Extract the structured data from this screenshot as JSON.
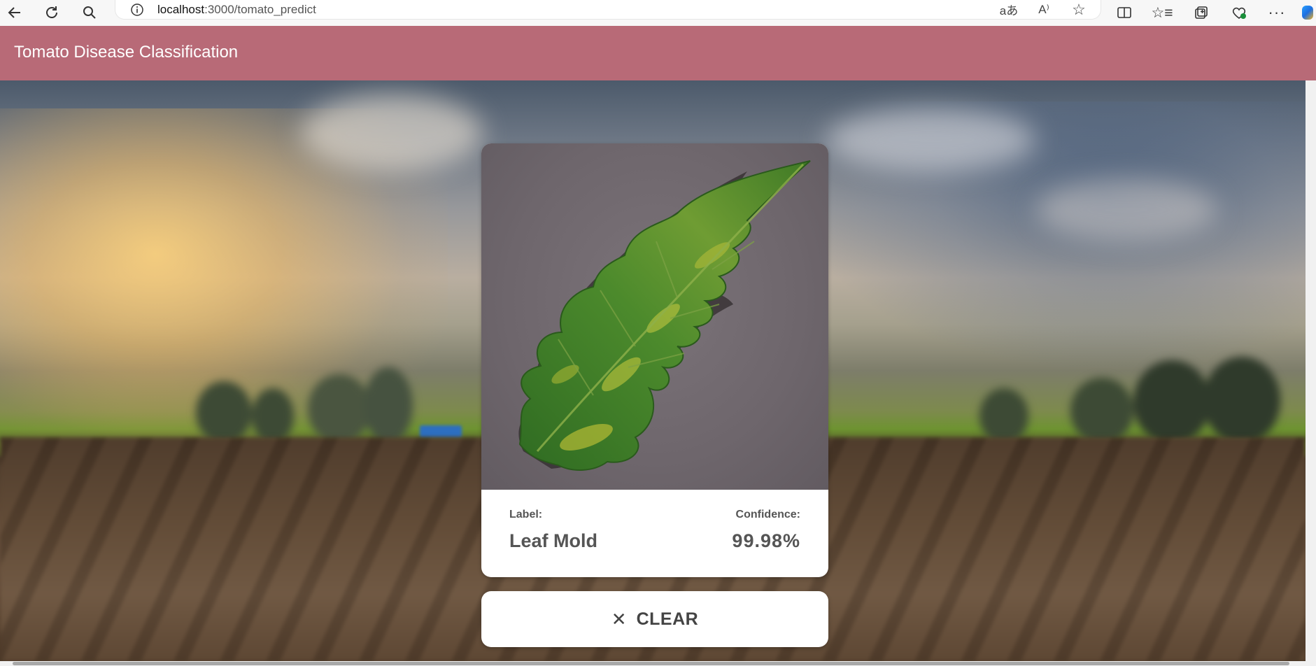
{
  "browser": {
    "url_host": "localhost",
    "url_path": ":3000/tomato_predict",
    "nav_icons": [
      "back-arrow-icon",
      "refresh-icon",
      "search-icon",
      "info-icon"
    ],
    "toolbar_icons": [
      "translate-icon",
      "read-aloud-icon",
      "favorite-star-icon",
      "split-screen-icon",
      "favorites-icon",
      "collections-icon",
      "health-icon",
      "more-menu-icon",
      "copilot-icon"
    ]
  },
  "app": {
    "title": "Tomato Disease Classification",
    "header_color": "#b86a77"
  },
  "result": {
    "label_heading": "Label:",
    "label_value": "Leaf Mold",
    "confidence_heading": "Confidence:",
    "confidence_value": "99.98%"
  },
  "actions": {
    "clear_icon": "close-icon",
    "clear_label": "CLEAR"
  }
}
